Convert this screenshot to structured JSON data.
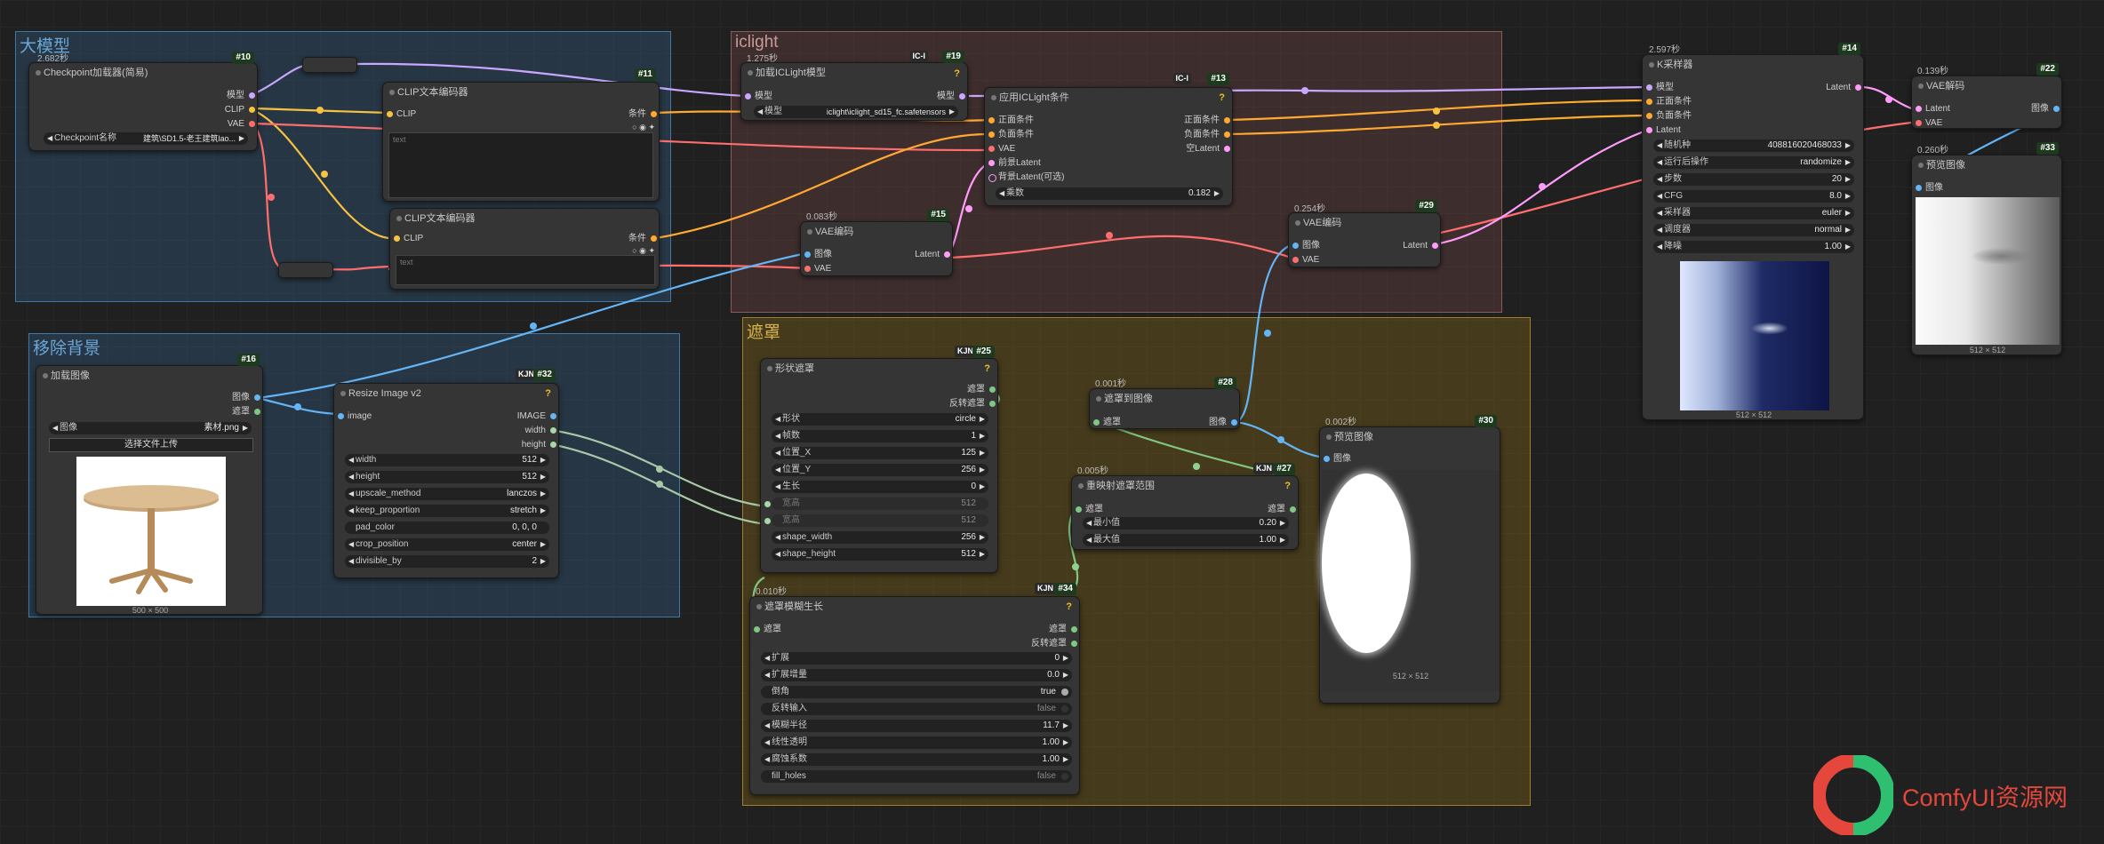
{
  "groups": {
    "model": "大模型",
    "iclight": "iclight",
    "remove_bg": "移除背景",
    "mask": "遮罩"
  },
  "colors": {
    "clip": "#f5c242",
    "model": "#c9a6ff",
    "vae": "#ff6e6e",
    "cond": "#ffa931",
    "latent": "#ff9cf9",
    "image": "#64b5f6",
    "mask": "#81c784"
  },
  "nodes": {
    "n10": {
      "time": "2.682秒",
      "badge": "#10",
      "title": "Checkpoint加载器(简易)",
      "outs": [
        "模型",
        "CLIP",
        "VAE"
      ],
      "widget_label": "Checkpoint名称",
      "widget_value": "建筑\\SD1.5-老王建筑lao..."
    },
    "n11": {
      "badge": "#11",
      "title": "CLIP文本编码器",
      "in": "CLIP",
      "out": "条件",
      "text": "text"
    },
    "n12": {
      "title": "CLIP文本编码器",
      "in": "CLIP",
      "out": "条件",
      "text": "text"
    },
    "n19": {
      "time": "1.275秒",
      "badge": "#19",
      "kbadge": "IC-l",
      "title": "加载ICLight模型",
      "in": "模型",
      "out": "模型",
      "widget_label": "模型",
      "widget_value": "iclight\\iclight_sd15_fc.safetensors"
    },
    "n13": {
      "badge": "#13",
      "kbadge": "IC-l",
      "title": "应用ICLight条件",
      "ins": [
        "正面条件",
        "负面条件",
        "VAE",
        "前景Latent",
        "背景Latent(可选)"
      ],
      "outs": [
        "正面条件",
        "负面条件",
        "空Latent"
      ],
      "widget_label": "乘数",
      "widget_value": "0.182"
    },
    "n15": {
      "time": "0.083秒",
      "badge": "#15",
      "title": "VAE编码",
      "ins": [
        "图像",
        "VAE"
      ],
      "out": "Latent"
    },
    "n29": {
      "time": "0.254秒",
      "badge": "#29",
      "title": "VAE编码",
      "ins": [
        "图像",
        "VAE"
      ],
      "out": "Latent"
    },
    "n14": {
      "time": "2.597秒",
      "badge": "#14",
      "title": "K采样器",
      "ins": [
        "模型",
        "正面条件",
        "负面条件",
        "Latent"
      ],
      "out": "Latent",
      "widgets": [
        [
          "随机种",
          "408816020468033"
        ],
        [
          "运行后操作",
          "randomize"
        ],
        [
          "步数",
          "20"
        ],
        [
          "CFG",
          "8.0"
        ],
        [
          "采样器",
          "euler"
        ],
        [
          "调度器",
          "normal"
        ],
        [
          "降噪",
          "1.00"
        ]
      ],
      "caption": "512 × 512"
    },
    "n22": {
      "time": "0.139秒",
      "badge": "#22",
      "title": "VAE解码",
      "ins": [
        "Latent",
        "VAE"
      ],
      "out": "图像"
    },
    "n33": {
      "time": "0.260秒",
      "badge": "#33",
      "title": "预览图像",
      "in": "图像",
      "caption": "512 × 512"
    },
    "n16": {
      "badge": "#16",
      "title": "加载图像",
      "outs": [
        "图像",
        "遮罩"
      ],
      "widget_label": "图像",
      "widget_value": "素材.png",
      "button": "选择文件上传",
      "caption": "500 × 500"
    },
    "n32": {
      "badge": "#32",
      "kbadge": "KJN",
      "title": "Resize Image v2",
      "in": "image",
      "outs": [
        "IMAGE",
        "width",
        "height"
      ],
      "widgets": [
        [
          "width",
          "512"
        ],
        [
          "height",
          "512"
        ],
        [
          "upscale_method",
          "lanczos"
        ],
        [
          "keep_proportion",
          "stretch"
        ],
        [
          "pad_color",
          "0, 0, 0"
        ],
        [
          "crop_position",
          "center"
        ],
        [
          "divisible_by",
          "2"
        ]
      ]
    },
    "n25": {
      "badge": "#25",
      "kbadge": "KJN",
      "title": "形状遮罩",
      "outs": [
        "遮罩",
        "反转遮罩"
      ],
      "widgets": [
        [
          "形状",
          "circle"
        ],
        [
          "帧数",
          "1"
        ],
        [
          "位置_X",
          "125"
        ],
        [
          "位置_Y",
          "256"
        ],
        [
          "生长",
          "0"
        ],
        [
          "宽高",
          "512"
        ],
        [
          "宽高",
          "512"
        ],
        [
          "shape_width",
          "256"
        ],
        [
          "shape_height",
          "512"
        ]
      ]
    },
    "n28": {
      "time": "0.001秒",
      "badge": "#28",
      "title": "遮罩到图像",
      "in": "遮罩",
      "out": "图像"
    },
    "n27": {
      "time": "0.005秒",
      "badge": "#27",
      "kbadge": "KJN",
      "title": "重映射遮罩范围",
      "in": "遮罩",
      "out": "遮罩",
      "widgets": [
        [
          "最小值",
          "0.20"
        ],
        [
          "最大值",
          "1.00"
        ]
      ]
    },
    "n30": {
      "time": "0.002秒",
      "badge": "#30",
      "title": "预览图像",
      "in": "图像",
      "caption": "512 × 512"
    },
    "n34": {
      "time": "0.010秒",
      "badge": "#34",
      "kbadge": "KJN",
      "title": "遮罩模糊生长",
      "in": "遮罩",
      "outs": [
        "遮罩",
        "反转遮罩"
      ],
      "widgets": [
        [
          "扩展",
          "0"
        ],
        [
          "扩展增量",
          "0.0"
        ],
        [
          "倒角",
          "true"
        ],
        [
          "反转输入",
          "false"
        ],
        [
          "模糊半径",
          "11.7"
        ],
        [
          "线性透明",
          "1.00"
        ],
        [
          "腐蚀系数",
          "1.00"
        ],
        [
          "fill_holes",
          "false"
        ]
      ]
    }
  },
  "watermark": "ComfyUI资源网"
}
